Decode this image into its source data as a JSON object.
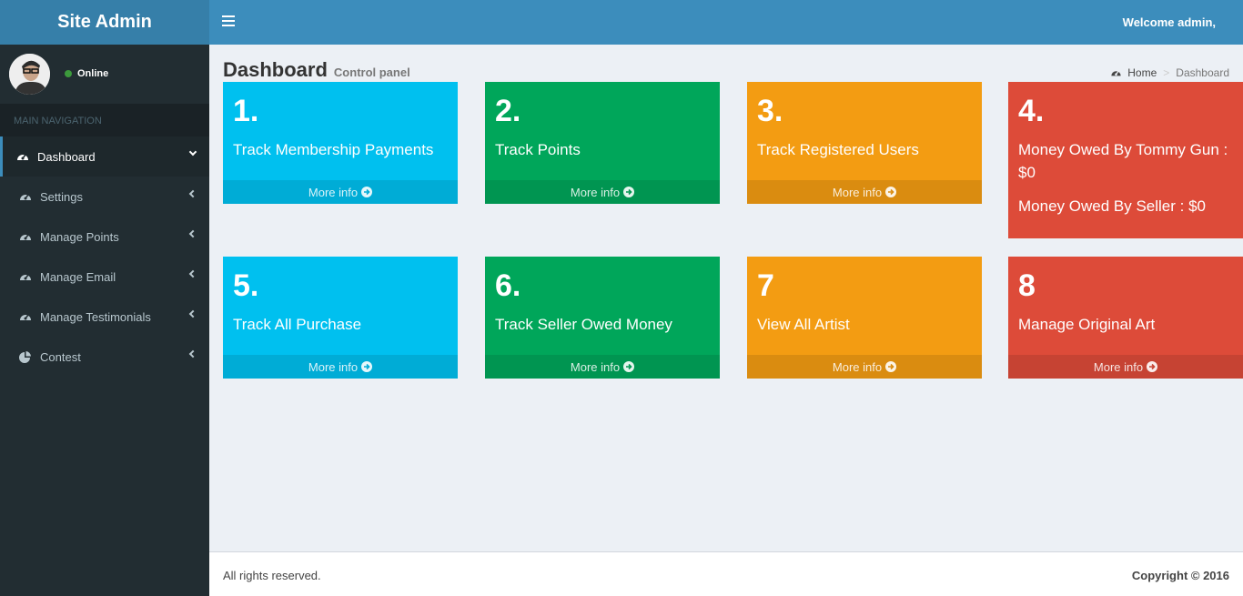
{
  "app": {
    "logo_text": "Site Admin",
    "welcome": "Welcome admin,"
  },
  "colors": {
    "header": "#3c8dbc",
    "logo": "#367fa9",
    "sidebar": "#222d32",
    "aqua": "#00c0ef",
    "green": "#00a65a",
    "yellow": "#f39c12",
    "red": "#dd4b39"
  },
  "user": {
    "status": "Online"
  },
  "sidebar": {
    "header": "MAIN NAVIGATION",
    "items": [
      {
        "label": "Dashboard",
        "icon": "dashboard-icon"
      },
      {
        "label": "Settings",
        "icon": "dashboard-icon"
      },
      {
        "label": "Manage Points",
        "icon": "dashboard-icon"
      },
      {
        "label": "Manage Email",
        "icon": "dashboard-icon"
      },
      {
        "label": "Manage Testimonials",
        "icon": "dashboard-icon"
      },
      {
        "label": "Contest",
        "icon": "pie-chart-icon"
      }
    ]
  },
  "page": {
    "title": "Dashboard",
    "subtitle": "Control panel"
  },
  "breadcrumb": {
    "home": "Home",
    "current": "Dashboard"
  },
  "boxes": [
    {
      "num": "1.",
      "title": "Track Membership Payments",
      "more": "More info"
    },
    {
      "num": "2.",
      "title": "Track Points",
      "more": "More info"
    },
    {
      "num": "3.",
      "title": "Track Registered Users",
      "more": "More info"
    },
    {
      "num": "4.",
      "line1": "Money Owed By Tommy Gun :",
      "line2": "$0",
      "line3": "Money Owed By Seller : $0"
    },
    {
      "num": "5.",
      "title": "Track All Purchase",
      "more": "More info"
    },
    {
      "num": "6.",
      "title": "Track Seller Owed Money",
      "more": "More info"
    },
    {
      "num": "7",
      "title": "View All Artist",
      "more": "More info"
    },
    {
      "num": "8",
      "title": "Manage Original Art",
      "more": "More info"
    }
  ],
  "footer": {
    "left": "All rights reserved.",
    "right": "Copyright © 2016"
  }
}
